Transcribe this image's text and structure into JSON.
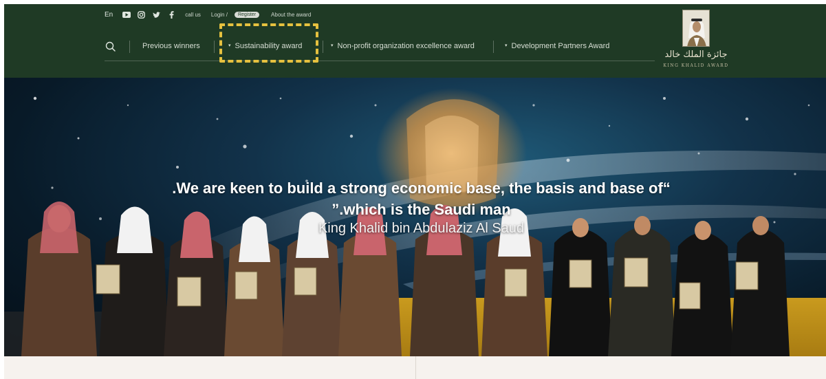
{
  "topbar": {
    "lang": "En",
    "social_icons": [
      "youtube-icon",
      "instagram-icon",
      "twitter-icon",
      "facebook-icon"
    ],
    "call_us": "call us",
    "login": "Login /",
    "register": "Register",
    "about": "About the award"
  },
  "nav": {
    "search_icon": "search-icon",
    "items": [
      {
        "label": "Previous winners"
      },
      {
        "label": "Sustainability award"
      },
      {
        "label": "Non-profit organization excellence award"
      },
      {
        "label": "Development Partners Award"
      }
    ]
  },
  "logo": {
    "arabic": "جائزة الملك خالد",
    "english": "KING KHALID AWARD"
  },
  "hero": {
    "quote_line1": ".We are keen to build a strong economic base, the basis and base of“",
    "quote_line2": "”.which is the Saudi man",
    "attribution": "King Khalid bin Abdulaziz Al Saud"
  },
  "colors": {
    "header_bg": "#1f3a25",
    "highlight": "#e6c13f",
    "band_bg": "#f6f2ee"
  }
}
